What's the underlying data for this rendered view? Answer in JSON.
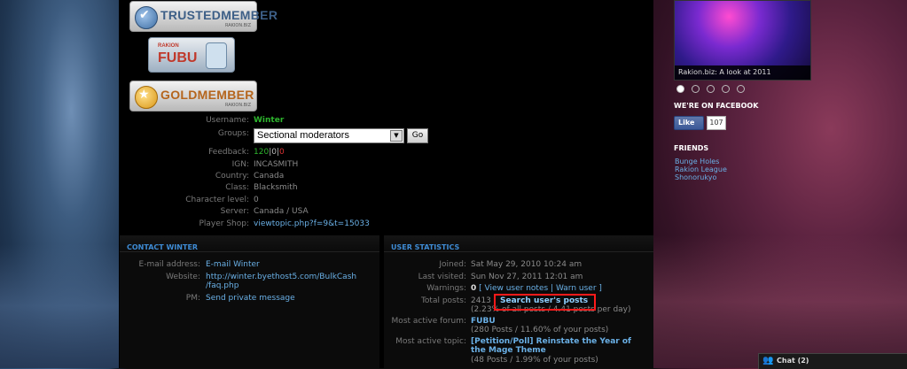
{
  "badges": {
    "trusted": {
      "label": "TRUSTEDMEMBER",
      "sub": "RAKION.BIZ"
    },
    "fubu": {
      "top": "RAKION",
      "main": "FUBU"
    },
    "gold": {
      "label": "GOLDMEMBER",
      "sub": "RAKION.BIZ"
    }
  },
  "profile": {
    "username_label": "Username:",
    "username": "Winter",
    "groups_label": "Groups:",
    "groups_selected": "Sectional moderators",
    "go_label": "Go",
    "feedback_label": "Feedback:",
    "feedback_pos": "120",
    "feedback_sep1": "|",
    "feedback_neu": "0",
    "feedback_sep2": "|",
    "feedback_neg": "0",
    "ign_label": "IGN:",
    "ign": "INCASMITH",
    "country_label": "Country:",
    "country": "Canada",
    "class_label": "Class:",
    "class": "Blacksmith",
    "charlevel_label": "Character level:",
    "charlevel": "0",
    "server_label": "Server:",
    "server": "Canada / USA",
    "shop_label": "Player Shop:",
    "shop": "viewtopic.php?f=9&t=15033"
  },
  "contact": {
    "heading": "CONTACT WINTER",
    "email_label": "E-mail address:",
    "email": "E-mail Winter",
    "website_label": "Website:",
    "website_line1": "http://winter.byethost5.com/BulkCash",
    "website_line2": "/faq.php",
    "pm_label": "PM:",
    "pm": "Send private message"
  },
  "stats": {
    "heading": "USER STATISTICS",
    "joined_label": "Joined:",
    "joined": "Sat May 29, 2010 10:24 am",
    "visited_label": "Last visited:",
    "visited": "Sun Nov 27, 2011 12:01 am",
    "warnings_label": "Warnings:",
    "warnings": "0",
    "warn_links": "[ View user notes | Warn user ]",
    "posts_label": "Total posts:",
    "posts": "2413",
    "search_posts": "Search user's posts",
    "posts_sub": "(2.23% of all posts / 4.41 posts per day)",
    "forum_label": "Most active forum:",
    "forum": "FUBU",
    "forum_sub": "(280 Posts / 11.60% of your posts)",
    "topic_label": "Most active topic:",
    "topic_line1": "[Petition/Poll] Reinstate the Year of",
    "topic_line2": "the Mage Theme",
    "topic_sub": "(48 Posts / 1.99% of your posts)"
  },
  "sidebar": {
    "thumb_caption": "Rakion.biz: A look at 2011",
    "facebook_heading": "WE'RE ON FACEBOOK",
    "like_label": "Like",
    "like_count": "107",
    "friends_heading": "FRIENDS",
    "friends": [
      "Bunge Holes",
      "Rakion League",
      "Shonorukyo"
    ]
  },
  "chat": {
    "label": "Chat (2)"
  }
}
